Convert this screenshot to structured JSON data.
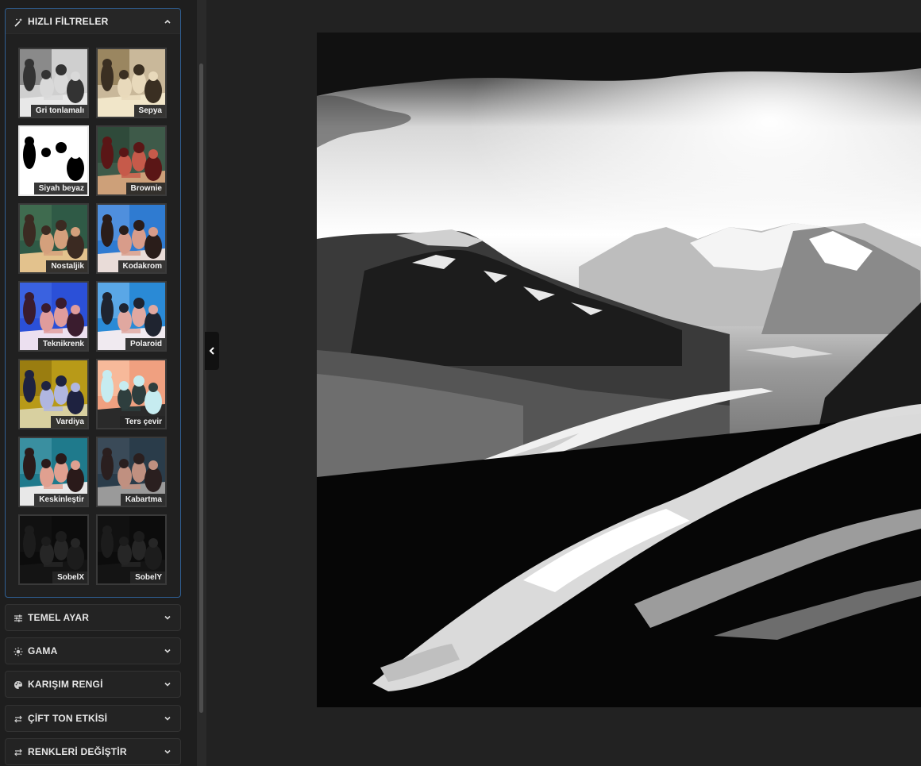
{
  "panels": {
    "quick_filters": {
      "title": "HIZLI FİLTRELER",
      "icon": "magic-wand-icon",
      "expanded": true
    },
    "basic": {
      "title": "TEMEL AYAR",
      "icon": "sliders-icon"
    },
    "gamma": {
      "title": "GAMA",
      "icon": "sun-icon"
    },
    "blend": {
      "title": "KARIŞIM RENGİ",
      "icon": "palette-icon"
    },
    "duotone": {
      "title": "ÇİFT TON ETKİSİ",
      "icon": "swap-icon"
    },
    "swap_colors": {
      "title": "RENKLERİ DEĞİŞTİR",
      "icon": "swap-icon"
    }
  },
  "filters": [
    {
      "label": "Gri tonlamalı",
      "selected": false
    },
    {
      "label": "Sepya",
      "selected": false
    },
    {
      "label": "Siyah beyaz",
      "selected": true
    },
    {
      "label": "Brownie",
      "selected": false
    },
    {
      "label": "Nostaljik",
      "selected": false
    },
    {
      "label": "Kodakrom",
      "selected": false
    },
    {
      "label": "Teknikrenk",
      "selected": false
    },
    {
      "label": "Polaroid",
      "selected": false
    },
    {
      "label": "Vardiya",
      "selected": false
    },
    {
      "label": "Ters çevir",
      "selected": false
    },
    {
      "label": "Keskinleştir",
      "selected": false
    },
    {
      "label": "Kabartma",
      "selected": false
    },
    {
      "label": "SobelX",
      "selected": false
    },
    {
      "label": "SobelY",
      "selected": false
    }
  ],
  "colors": {
    "accent": "#2f5f93",
    "sidebar_bg": "#1e1e1e",
    "main_bg": "#222222"
  }
}
